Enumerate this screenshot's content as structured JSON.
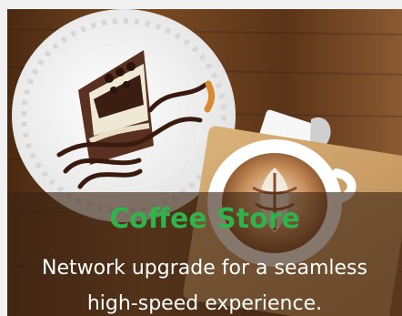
{
  "card": {
    "image_subject": "cake-and-latte",
    "title": "Coffee Store",
    "subtitle": "Network upgrade for a seamless high-speed experience.",
    "title_color": "#2fb34a",
    "subtitle_color": "#ffffff",
    "overlay_color": "rgba(60,35,20,0.62)"
  }
}
